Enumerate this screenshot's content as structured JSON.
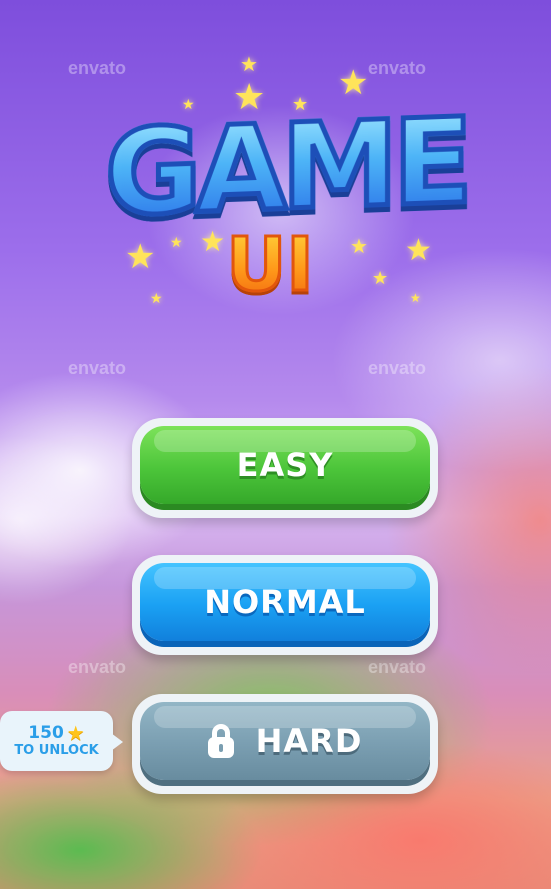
{
  "watermark": "envato",
  "logo": {
    "title": "GAME",
    "subtitle": "UI"
  },
  "buttons": {
    "easy": "EASY",
    "normal": "NORMAL",
    "hard": "HARD"
  },
  "unlock": {
    "cost": "150",
    "label": "TO UNLOCK",
    "icon": "star-icon"
  },
  "colors": {
    "easy": "#4cc53a",
    "normal": "#1aa0f3",
    "hard": "#7a9eb1",
    "star": "#ffe45a"
  }
}
